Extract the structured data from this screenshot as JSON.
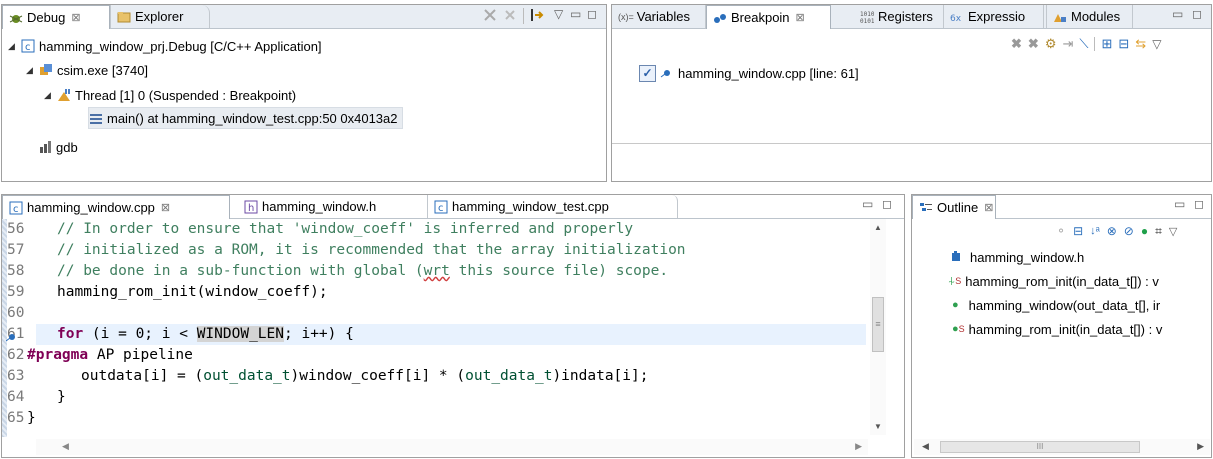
{
  "debug": {
    "tabs": [
      {
        "label": "Debug",
        "close": "⊠"
      },
      {
        "label": "Explorer"
      }
    ],
    "tree": {
      "app": "hamming_window_prj.Debug [C/C++ Application]",
      "process": "csim.exe [3740]",
      "thread": "Thread [1] 0 (Suspended : Breakpoint)",
      "frame": "main() at hamming_window_test.cpp:50 0x4013a2",
      "gdb": "gdb"
    }
  },
  "views": {
    "tabs": [
      {
        "label": "Variables",
        "prefix": "(x)="
      },
      {
        "label": "Breakpoin",
        "close": "⊠"
      },
      {
        "label": "Registers"
      },
      {
        "label": "Expressio"
      },
      {
        "label": "Modules"
      }
    ],
    "breakpoint": "hamming_window.cpp [line: 61]"
  },
  "editor": {
    "tabs": [
      {
        "label": "hamming_window.cpp",
        "close": "⊠"
      },
      {
        "label": "hamming_window.h"
      },
      {
        "label": "hamming_window_test.cpp"
      }
    ],
    "line_numbers": [
      "56",
      "57",
      "58",
      "59",
      "60",
      "61",
      "62",
      "63",
      "64",
      "65"
    ],
    "lines": {
      "l56": "// In order to ensure that 'window_coeff' is inferred and properly",
      "l57": "// initialized as a ROM, it is recommended that the array initialization",
      "l58a": "// be done in a sub-function with global (",
      "l58b": "wrt",
      "l58c": " this source file) scope.",
      "l59": "hamming_rom_init(window_coeff);",
      "l61kw": "for",
      "l61a": " (i = 0; i < ",
      "l61b": "WINDOW_LEN",
      "l61c": "; i++) {",
      "l62kw": "#pragma",
      "l62a": " AP pipeline",
      "l63a": "outdata[i] = (",
      "l63t1": "out_data_t",
      "l63b": ")window_coeff[i] * (",
      "l63t2": "out_data_t",
      "l63c": ")indata[i];",
      "l64": "}",
      "l65": "}"
    }
  },
  "outline": {
    "tab": {
      "label": "Outline",
      "close": "⊠"
    },
    "items": [
      {
        "label": "hamming_window.h"
      },
      {
        "label": "hamming_rom_init(in_data_t[]) : v",
        "superscript": "S"
      },
      {
        "label": "hamming_window(out_data_t[], ir"
      },
      {
        "label": "hamming_rom_init(in_data_t[]) : v",
        "superscript": "S"
      }
    ],
    "scroll_thumb": "III"
  },
  "colors": {
    "tab_bg": "#e8edf3",
    "comment": "#3f7f5f",
    "keyword": "#7f0055",
    "type": "#005032",
    "current_line": "#e8f2fe"
  }
}
